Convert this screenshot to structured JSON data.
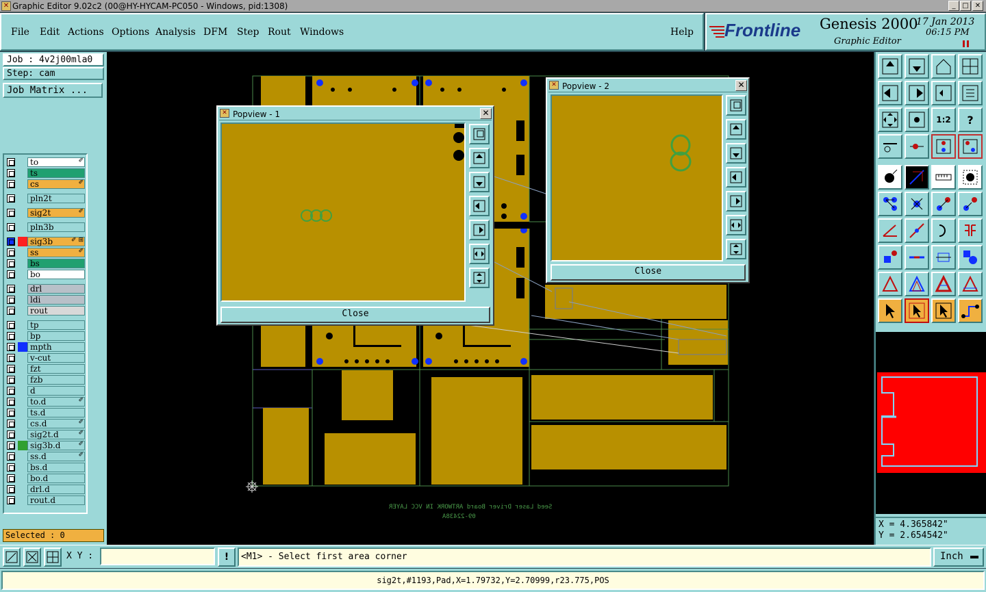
{
  "window": {
    "title": "Graphic Editor 9.02c2 (00@HY-HYCAM-PC050 - Windows, pid:1308)",
    "min": "_",
    "max": "□",
    "close": "✕"
  },
  "menu": {
    "file": "File",
    "edit": "Edit",
    "actions": "Actions",
    "options": "Options",
    "analysis": "Analysis",
    "dfm": "DFM",
    "step": "Step",
    "rout": "Rout",
    "windows": "Windows",
    "help": "Help"
  },
  "brand": {
    "logo": "Frontline",
    "product": "Genesis 2000",
    "subtitle": "Graphic Editor",
    "date": "17 Jan 2013",
    "time": "06:15 PM",
    "accent": "#c01010"
  },
  "job": {
    "job_label": "Job : 4v2j00mla0",
    "step_label": "Step: cam",
    "matrix_button": "Job Matrix ..."
  },
  "layers": [
    {
      "name": "to",
      "color": "#ffffff",
      "flag": "✐",
      "sw": ""
    },
    {
      "name": "ts",
      "color": "#20a070",
      "flag": "",
      "sw": ""
    },
    {
      "name": "cs",
      "color": "#f0b040",
      "flag": "✐",
      "sw": ""
    },
    {
      "name": "pln2t",
      "color": "#9cd8d8",
      "flag": "",
      "sw": ""
    },
    {
      "name": "sig2t",
      "color": "#f0b040",
      "flag": "✐",
      "sw": ""
    },
    {
      "name": "pln3b",
      "color": "#9cd8d8",
      "flag": "",
      "sw": ""
    },
    {
      "name": "sig3b",
      "color": "#f0b040",
      "flag": "✐ ⊞",
      "sw": "#ff2020",
      "active": true
    },
    {
      "name": "ss",
      "color": "#f0b040",
      "flag": "✐",
      "sw": ""
    },
    {
      "name": "bs",
      "color": "#20a070",
      "flag": "",
      "sw": ""
    },
    {
      "name": "bo",
      "color": "#ffffff",
      "flag": "",
      "sw": ""
    },
    {
      "name": "drl",
      "color": "#b8c0c8",
      "flag": "",
      "sw": ""
    },
    {
      "name": "ldi",
      "color": "#b8c0c8",
      "flag": "",
      "sw": ""
    },
    {
      "name": "rout",
      "color": "#d8d8d8",
      "flag": "",
      "sw": ""
    },
    {
      "name": "tp",
      "color": "#9cd8d8",
      "flag": "",
      "sw": ""
    },
    {
      "name": "bp",
      "color": "#9cd8d8",
      "flag": "",
      "sw": ""
    },
    {
      "name": "mpth",
      "color": "#9cd8d8",
      "flag": "",
      "sw": "#1030ff"
    },
    {
      "name": "v-cut",
      "color": "#9cd8d8",
      "flag": "",
      "sw": ""
    },
    {
      "name": "fzt",
      "color": "#9cd8d8",
      "flag": "",
      "sw": ""
    },
    {
      "name": "fzb",
      "color": "#9cd8d8",
      "flag": "",
      "sw": ""
    },
    {
      "name": "d",
      "color": "#9cd8d8",
      "flag": "",
      "sw": ""
    },
    {
      "name": "to.d",
      "color": "#9cd8d8",
      "flag": "✐",
      "sw": ""
    },
    {
      "name": "ts.d",
      "color": "#9cd8d8",
      "flag": "",
      "sw": ""
    },
    {
      "name": "cs.d",
      "color": "#9cd8d8",
      "flag": "✐",
      "sw": ""
    },
    {
      "name": "sig2t.d",
      "color": "#9cd8d8",
      "flag": "✐",
      "sw": ""
    },
    {
      "name": "sig3b.d",
      "color": "#9cd8d8",
      "flag": "✐",
      "sw": "#30a030"
    },
    {
      "name": "ss.d",
      "color": "#9cd8d8",
      "flag": "✐",
      "sw": ""
    },
    {
      "name": "bs.d",
      "color": "#9cd8d8",
      "flag": "",
      "sw": ""
    },
    {
      "name": "bo.d",
      "color": "#9cd8d8",
      "flag": "",
      "sw": ""
    },
    {
      "name": "drl.d",
      "color": "#9cd8d8",
      "flag": "",
      "sw": ""
    },
    {
      "name": "rout.d",
      "color": "#9cd8d8",
      "flag": "",
      "sw": ""
    }
  ],
  "selected": "Selected : 0",
  "canvas": {
    "mirror_text_1": "Seed Laser Driver Board ARTWORK IN VCC LAYER",
    "mirror_text_2": "09-22438A"
  },
  "popview1": {
    "title": "Popview - 1",
    "close": "Close"
  },
  "popview2": {
    "title": "Popview - 2",
    "close": "Close"
  },
  "coords": {
    "x": "X = 4.365842\"",
    "y": "Y = 2.654542\""
  },
  "bottom": {
    "xy_label": "X Y :",
    "xy_value": "",
    "warn": "!",
    "prompt": "<M1> - Select first area corner",
    "units": "Inch"
  },
  "status": "sig2t,#1193,Pad,X=1.79732,Y=2.70999,r23.775,POS",
  "tool_labels": {
    "ratio": "1:2",
    "help": "?"
  }
}
